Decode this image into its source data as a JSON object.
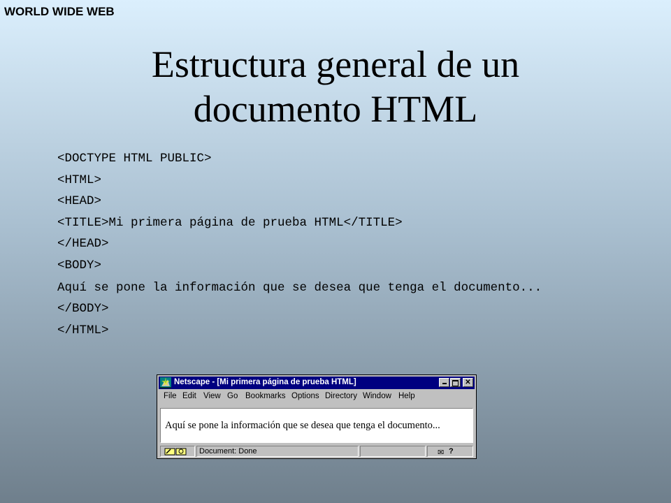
{
  "header_label": "WORLD WIDE WEB",
  "title_lines": [
    "Estructura general de un",
    "documento HTML"
  ],
  "code_lines": [
    "<DOCTYPE HTML PUBLIC>",
    "<HTML>",
    "<HEAD>",
    "<TITLE>Mi primera página de prueba HTML</TITLE>",
    "</HEAD>",
    "<BODY>"
  ],
  "code_paragraph": "Aquí se pone la información que se desea que tenga el documento...",
  "code_lines_end": [
    "</BODY>",
    "</HTML>"
  ],
  "browser": {
    "title": "Netscape - [Mi primera página de prueba HTML]",
    "menu": [
      "File",
      "Edit",
      "View",
      "Go",
      "Bookmarks",
      "Options",
      "Directory",
      "Window",
      "Help"
    ],
    "content_text": "Aquí se pone la información que se desea que tenga el documento...",
    "status_text": "Document: Done",
    "colors": {
      "titlebar": "#000080",
      "face": "#c0c0c0"
    }
  }
}
